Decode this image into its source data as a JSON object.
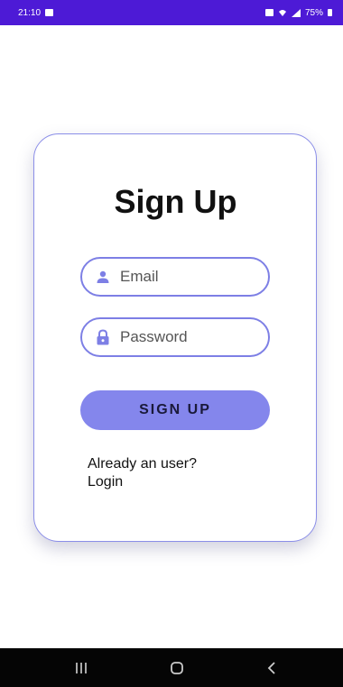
{
  "status_bar": {
    "time": "21:10",
    "battery": "75%"
  },
  "form": {
    "title": "Sign Up",
    "email_placeholder": "Email",
    "password_placeholder": "Password",
    "signup_label": "SIGN UP",
    "login_line1": "Already an user?",
    "login_line2": "Login"
  },
  "icons": {
    "email": "person-icon",
    "password": "lock-icon"
  },
  "colors": {
    "status_bar": "#4d1ad6",
    "accent": "#8486ec",
    "border": "#7d7fe5",
    "nav_bar": "#050505"
  }
}
